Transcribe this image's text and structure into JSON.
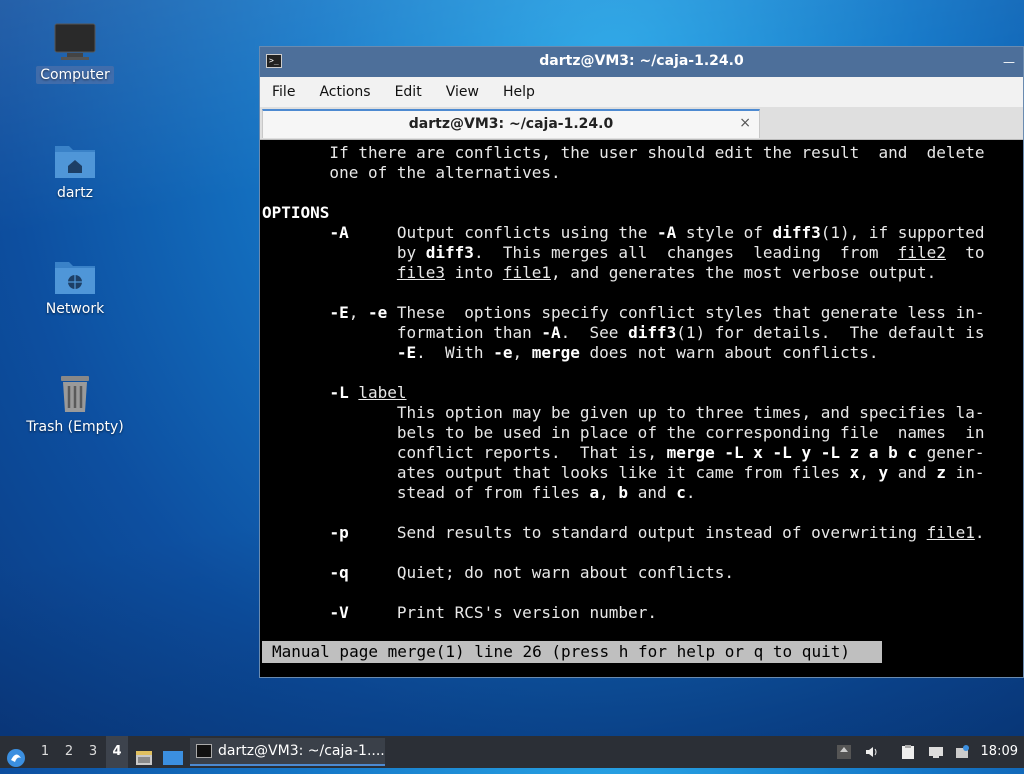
{
  "desktop": {
    "icons": [
      {
        "label": "Computer"
      },
      {
        "label": "dartz"
      },
      {
        "label": "Network"
      },
      {
        "label": "Trash (Empty)"
      }
    ]
  },
  "window": {
    "title": "dartz@VM3: ~/caja-1.24.0",
    "menu": [
      "File",
      "Actions",
      "Edit",
      "View",
      "Help"
    ],
    "tab_title": "dartz@VM3: ~/caja-1.24.0",
    "tab_close": "×"
  },
  "terminal": {
    "lines": [
      [
        [
          "       If there are conflicts, the user should edit the result  and  delete",
          ""
        ]
      ],
      [
        [
          "       one of the alternatives.",
          ""
        ]
      ],
      [
        [
          "",
          ""
        ]
      ],
      [
        [
          "OPTIONS",
          "b"
        ]
      ],
      [
        [
          "       ",
          ""
        ],
        [
          "-A",
          "b"
        ],
        [
          "     Output conflicts using the ",
          ""
        ],
        [
          "-A",
          "b"
        ],
        [
          " style of ",
          ""
        ],
        [
          "diff3",
          "b"
        ],
        [
          "(1), if supported",
          ""
        ]
      ],
      [
        [
          "              by ",
          ""
        ],
        [
          "diff3",
          "b"
        ],
        [
          ".  This merges all  changes  leading  from  ",
          ""
        ],
        [
          "file2",
          "u"
        ],
        [
          "  to",
          ""
        ]
      ],
      [
        [
          "              ",
          ""
        ],
        [
          "file3",
          "u"
        ],
        [
          " into ",
          ""
        ],
        [
          "file1",
          "u"
        ],
        [
          ", and generates the most verbose output.",
          ""
        ]
      ],
      [
        [
          "",
          ""
        ]
      ],
      [
        [
          "       ",
          ""
        ],
        [
          "-E",
          "b"
        ],
        [
          ", ",
          ""
        ],
        [
          "-e",
          "b"
        ],
        [
          " These  options specify conflict styles that generate less in-",
          ""
        ]
      ],
      [
        [
          "              formation than ",
          ""
        ],
        [
          "-A",
          "b"
        ],
        [
          ".  See ",
          ""
        ],
        [
          "diff3",
          "b"
        ],
        [
          "(1) for details.  The default is",
          ""
        ]
      ],
      [
        [
          "              ",
          ""
        ],
        [
          "-E",
          "b"
        ],
        [
          ".  With ",
          ""
        ],
        [
          "-e",
          "b"
        ],
        [
          ", ",
          ""
        ],
        [
          "merge",
          "b"
        ],
        [
          " does not warn about conflicts.",
          ""
        ]
      ],
      [
        [
          "",
          ""
        ]
      ],
      [
        [
          "       ",
          ""
        ],
        [
          "-L",
          "b"
        ],
        [
          " ",
          ""
        ],
        [
          "label",
          "u"
        ]
      ],
      [
        [
          "              This option may be given up to three times, and specifies la-",
          ""
        ]
      ],
      [
        [
          "              bels to be used in place of the corresponding file  names  in",
          ""
        ]
      ],
      [
        [
          "              conflict reports.  That is, ",
          ""
        ],
        [
          "merge -L x -L y -L z a b c",
          "b"
        ],
        [
          " gener-",
          ""
        ]
      ],
      [
        [
          "              ates output that looks like it came from files ",
          ""
        ],
        [
          "x",
          "b"
        ],
        [
          ", ",
          ""
        ],
        [
          "y",
          "b"
        ],
        [
          " and ",
          ""
        ],
        [
          "z",
          "b"
        ],
        [
          " in-",
          ""
        ]
      ],
      [
        [
          "              stead of from files ",
          ""
        ],
        [
          "a",
          "b"
        ],
        [
          ", ",
          ""
        ],
        [
          "b",
          "b"
        ],
        [
          " and ",
          ""
        ],
        [
          "c",
          "b"
        ],
        [
          ".",
          ""
        ]
      ],
      [
        [
          "",
          ""
        ]
      ],
      [
        [
          "       ",
          ""
        ],
        [
          "-p",
          "b"
        ],
        [
          "     Send results to standard output instead of overwriting ",
          ""
        ],
        [
          "file1",
          "u"
        ],
        [
          ".",
          ""
        ]
      ],
      [
        [
          "",
          ""
        ]
      ],
      [
        [
          "       ",
          ""
        ],
        [
          "-q",
          "b"
        ],
        [
          "     Quiet; do not warn about conflicts.",
          ""
        ]
      ],
      [
        [
          "",
          ""
        ]
      ],
      [
        [
          "       ",
          ""
        ],
        [
          "-V",
          "b"
        ],
        [
          "     Print RCS's version number.",
          ""
        ]
      ]
    ],
    "status": "Manual page merge(1) line 26 (press h for help or q to quit)"
  },
  "taskbar": {
    "workspaces": [
      "1",
      "2",
      "3",
      "4"
    ],
    "active_workspace": "4",
    "task_label": "dartz@VM3: ~/caja-1....",
    "clock": "18:09"
  }
}
